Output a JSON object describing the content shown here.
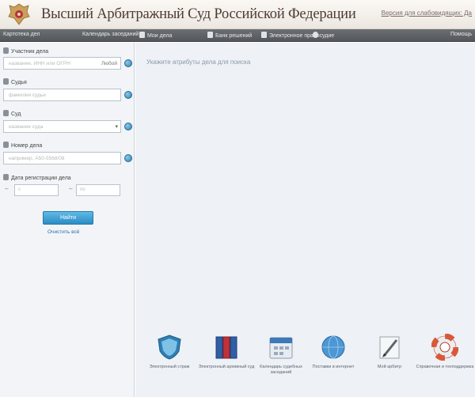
{
  "header": {
    "title": "Высший Арбитражный Суд Российской Федерации",
    "right_link": "Версия для слабовидящих: Да"
  },
  "topnav": {
    "items": [
      {
        "label": "Картотека дел"
      },
      {
        "label": "Календарь заседаний"
      },
      {
        "label": "Мои дела"
      },
      {
        "label": "Банк решений"
      },
      {
        "label": "Электронное правосудие"
      },
      {
        "label": "Помощь"
      }
    ]
  },
  "sidebar": {
    "participant": {
      "label": "Участник дела",
      "placeholder": "название, ИНН или ОГРН",
      "toggle": "Любой"
    },
    "judge": {
      "label": "Судья",
      "placeholder": "фамилия судьи"
    },
    "court": {
      "label": "Суд",
      "placeholder": "название суда"
    },
    "case_number": {
      "label": "Номер дела",
      "placeholder": "например, А50-5568/08"
    },
    "reg_date": {
      "label": "Дата регистрации дела",
      "from_placeholder": "с",
      "to_placeholder": "по"
    },
    "search_button": "Найти",
    "clear_link": "Очистить всё"
  },
  "main": {
    "hint": "Укажите атрибуты дела для поиска",
    "tiles": [
      {
        "label": "Электронный страж",
        "icon": "shield-icon"
      },
      {
        "label": "Электронный архивный суд",
        "icon": "books-icon"
      },
      {
        "label": "Календарь судебных заседаний",
        "icon": "calendar-icon"
      },
      {
        "label": "Поставки в интернет",
        "icon": "globe-icon"
      },
      {
        "label": "Мой арбитр",
        "icon": "pen-icon"
      },
      {
        "label": "Справочная и техподдержка",
        "icon": "lifebuoy-icon"
      }
    ]
  },
  "colors": {
    "accent": "#2b8cc4",
    "nav_bg": "#5e6267",
    "title": "#4e3a37"
  }
}
